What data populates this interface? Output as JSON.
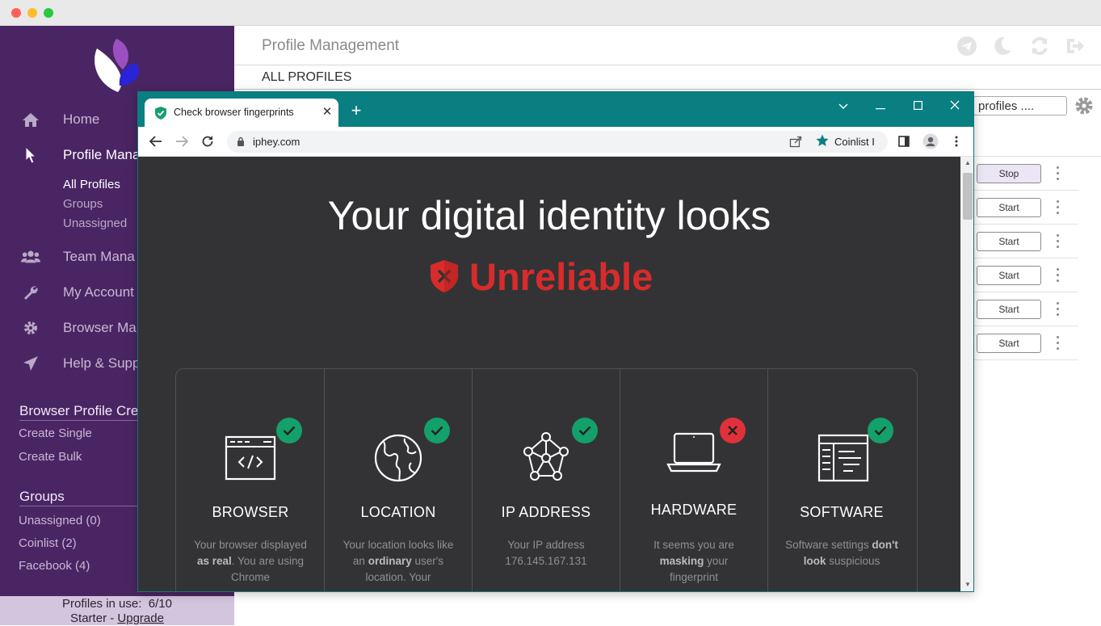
{
  "sidebar": {
    "nav": [
      {
        "label": "Home",
        "icon": "home-icon"
      },
      {
        "label": "Profile Mana",
        "icon": "cursor-icon"
      },
      {
        "label": "Team Mana",
        "icon": "team-icon"
      },
      {
        "label": "My Account",
        "icon": "wrench-icon"
      },
      {
        "label": "Browser Ma",
        "icon": "gear-icon"
      },
      {
        "label": "Help & Supp",
        "icon": "paper-plane-icon"
      }
    ],
    "profile_sub": [
      "All Profiles",
      "Groups",
      "Unassigned"
    ],
    "creation_title": "Browser Profile Cre",
    "creation_items": [
      "Create Single",
      "Create Bulk"
    ],
    "groups_title": "Groups",
    "groups_items": [
      "Unassigned (0)",
      "Coinlist (2)",
      "Facebook (4)"
    ],
    "footer": {
      "usage_label": "Profiles in use:",
      "usage_value": "6/10",
      "plan": "Starter - ",
      "upgrade": "Upgrade"
    }
  },
  "header": {
    "title": "Profile Management"
  },
  "tabs": {
    "all_profiles": "ALL PROFILES"
  },
  "table": {
    "search_value": "profiles ....",
    "rows": [
      {
        "action": "Stop"
      },
      {
        "action": "Start"
      },
      {
        "action": "Start"
      },
      {
        "action": "Start"
      },
      {
        "action": "Start"
      },
      {
        "action": "Start"
      }
    ]
  },
  "browser": {
    "tab_title": "Check browser fingerprints",
    "url": "iphey.com",
    "bookmark": "Coinlist I",
    "headline": "Your digital identity looks",
    "verdict": "Unreliable",
    "cards": [
      {
        "title": "BROWSER",
        "status": "ok",
        "desc_pre": "Your browser displayed ",
        "desc_bold": "as real",
        "desc_post": ". You are using Chrome"
      },
      {
        "title": "LOCATION",
        "status": "ok",
        "desc_pre": "Your location looks like an ",
        "desc_bold": "ordinary",
        "desc_post": " user's location. Your"
      },
      {
        "title": "IP ADDRESS",
        "status": "ok",
        "desc_pre": "Your IP address 176.145.167.131",
        "desc_bold": "",
        "desc_post": ""
      },
      {
        "title": "HARDWARE",
        "status": "fail",
        "desc_pre": "It seems you are ",
        "desc_bold": "masking",
        "desc_post": " your fingerprint"
      },
      {
        "title": "SOFTWARE",
        "status": "ok",
        "desc_pre": "Software settings ",
        "desc_bold": "don't look",
        "desc_post": " suspicious"
      }
    ]
  },
  "colors": {
    "sidebar_bg": "#4a2563",
    "accent_teal": "#0a7f82",
    "ok_green": "#14a06b",
    "fail_red": "#e0303a",
    "verdict_red": "#d82b2b"
  }
}
